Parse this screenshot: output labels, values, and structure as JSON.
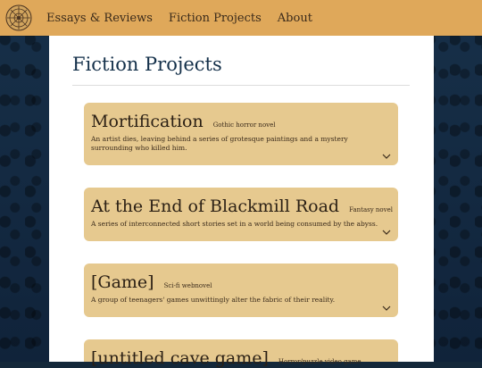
{
  "nav": {
    "logo_icon": "ornamental-medallion-icon",
    "links": [
      "Essays & Reviews",
      "Fiction Projects",
      "About"
    ]
  },
  "main": {
    "title": "Fiction Projects",
    "projects": [
      {
        "title": "Mortification",
        "genre": "Gothic horror novel",
        "description": "An artist dies, leaving behind a series of grotesque paintings and a mystery surrounding who killed him."
      },
      {
        "title": "At the End of Blackmill Road",
        "genre": "Fantasy novel",
        "description": "A series of interconnected short stories set in a world being consumed by the abyss."
      },
      {
        "title": "[Game]",
        "genre": "Sci-fi webnovel",
        "description": "A group of teenagers' games unwittingly alter the fabric of their reality."
      },
      {
        "title": "[untitled cave game]",
        "genre": "Horror/puzzle video game",
        "description": ""
      }
    ]
  },
  "colors": {
    "header": "#dfa85a",
    "card": "#e6c98f",
    "background": "#14283a",
    "title": "#14304a"
  }
}
